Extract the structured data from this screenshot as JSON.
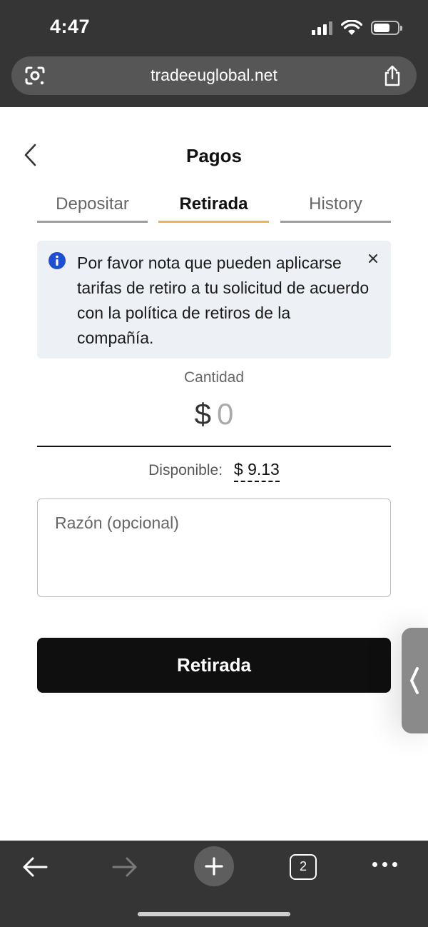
{
  "status_bar": {
    "time": "4:47",
    "battery_level": 0.7
  },
  "browser": {
    "url": "tradeeuglobal.net",
    "tab_count": "2",
    "icons": [
      "lens-icon",
      "share-icon",
      "back-arrow-icon",
      "forward-arrow-icon",
      "plus-icon",
      "tabs-icon",
      "more-icon"
    ]
  },
  "page": {
    "title": "Pagos",
    "tabs": [
      {
        "label": "Depositar",
        "active": false
      },
      {
        "label": "Retirada",
        "active": true
      },
      {
        "label": "History",
        "active": false
      }
    ],
    "notice": {
      "text": "Por favor nota que pueden aplicarse tarifas de retiro a tu solicitud de acuerdo con la política de retiros de la compañía."
    },
    "amount": {
      "label": "Cantidad",
      "currency": "$",
      "value": "0"
    },
    "available": {
      "label": "Disponible:",
      "value": "$ 9.13"
    },
    "reason": {
      "placeholder": "Razón (opcional)"
    },
    "submit_label": "Retirada"
  },
  "colors": {
    "chrome": "#353535",
    "active_tab_underline": "#e8b45a",
    "info_icon": "#1f4fd1",
    "button": "#0f0f0f",
    "notice_bg": "#edf0f4"
  }
}
